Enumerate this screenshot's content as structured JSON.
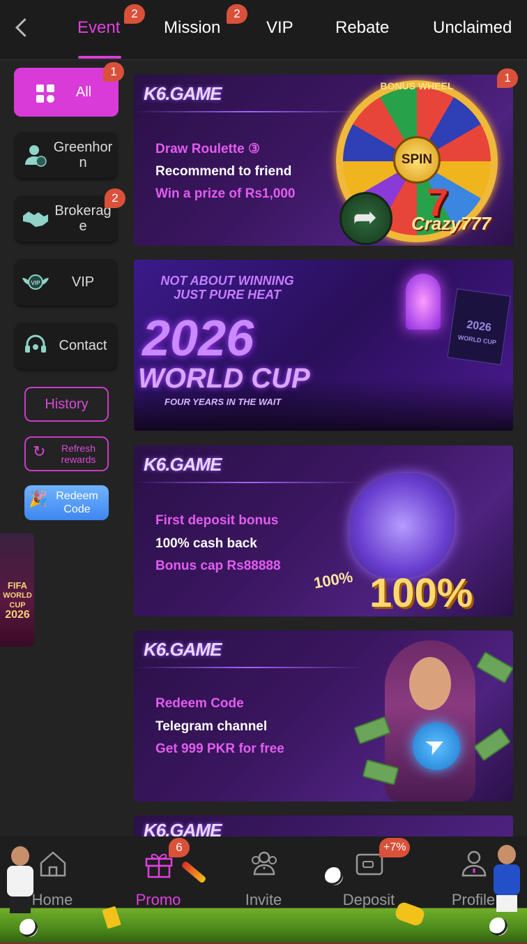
{
  "tabs": [
    {
      "label": "Event",
      "badge": "2",
      "active": true
    },
    {
      "label": "Mission",
      "badge": "2"
    },
    {
      "label": "VIP"
    },
    {
      "label": "Rebate"
    },
    {
      "label": "Unclaimed"
    }
  ],
  "sidebar": {
    "items": [
      {
        "label": "All",
        "badge": "1",
        "icon": "grid-icon",
        "active": true
      },
      {
        "label": "Greenhorn",
        "icon": "new-user-icon"
      },
      {
        "label": "Brokerage",
        "badge": "2",
        "icon": "handshake-icon"
      },
      {
        "label": "VIP",
        "icon": "vip-wings-icon"
      },
      {
        "label": "Contact",
        "icon": "headset-icon"
      }
    ],
    "history_label": "History",
    "refresh_label": "Refresh rewards",
    "redeem_label": "Redeem Code",
    "fifa_side": {
      "line1": "FIFA",
      "line2": "WORLD",
      "line3": "CUP",
      "line4": "2026"
    }
  },
  "banners": [
    {
      "brand": "K6.GAME",
      "badge": "1",
      "line1": "Draw Roulette ③",
      "line2": "Recommend to friend",
      "line3": "Win a prize of Rs1,000",
      "wheel_top": "BONUS WHEEL",
      "spin": "SPIN",
      "crazy": "Crazy777",
      "seven": "7"
    },
    {
      "top_text": "NOT ABOUT WINNING JUST PURE HEAT",
      "year": "2026",
      "name": "WORLD CUP",
      "sub": "FOUR YEARS IN THE WAIT",
      "flag_year": "2026",
      "flag_sub": "WORLD CUP"
    },
    {
      "brand": "K6.GAME",
      "line1": "First deposit bonus",
      "line2": "100% cash back",
      "line3": "Bonus cap Rs88888",
      "big": "100%",
      "small": "100%"
    },
    {
      "brand": "K6.GAME",
      "line1": "Redeem Code",
      "line2": "Telegram channel",
      "line3": "Get 999 PKR for free"
    },
    {
      "brand": "K6.GAME"
    }
  ],
  "bottom_nav": [
    {
      "label": "Home",
      "icon": "home-icon"
    },
    {
      "label": "Promo",
      "icon": "gift-icon",
      "badge": "6",
      "active": true
    },
    {
      "label": "Invite",
      "icon": "people-icon"
    },
    {
      "label": "Deposit",
      "icon": "wallet-icon",
      "badge": "+7%"
    },
    {
      "label": "Profile",
      "icon": "person-icon"
    }
  ],
  "colors": {
    "accent": "#d83bd8",
    "badge": "#d9513b",
    "background": "#232323"
  }
}
